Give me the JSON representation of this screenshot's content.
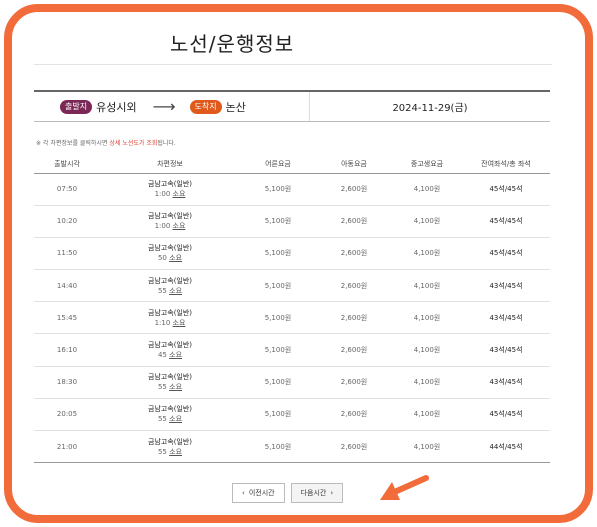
{
  "page": {
    "title": "노선/운행정보",
    "departure_badge": "출발지",
    "departure": "유성시외",
    "arrival_badge": "도착지",
    "arrival": "논산",
    "date": "2024-11-29(금)",
    "notice_prefix": "※ 각 차편정보를 클릭하시면 ",
    "notice_highlight": "상세 노선도가 조회",
    "notice_suffix": "됩니다."
  },
  "table": {
    "headers": [
      "출발시각",
      "차편정보",
      "어른요금",
      "아동요금",
      "중고생요금",
      "잔여좌석/총 좌석"
    ],
    "rows": [
      {
        "time": "07:50",
        "bus": "금남고속(일반)",
        "dur": "1:00",
        "dur_suffix": "소요",
        "adult": "5,100원",
        "child": "2,600원",
        "youth": "4,100원",
        "seats": "45석/45석"
      },
      {
        "time": "10:20",
        "bus": "금남고속(일반)",
        "dur": "1:00",
        "dur_suffix": "소요",
        "adult": "5,100원",
        "child": "2,600원",
        "youth": "4,100원",
        "seats": "45석/45석"
      },
      {
        "time": "11:50",
        "bus": "금남고속(일반)",
        "dur": "50",
        "dur_suffix": "소요",
        "adult": "5,100원",
        "child": "2,600원",
        "youth": "4,100원",
        "seats": "45석/45석"
      },
      {
        "time": "14:40",
        "bus": "금남고속(일반)",
        "dur": "55",
        "dur_suffix": "소요",
        "adult": "5,100원",
        "child": "2,600원",
        "youth": "4,100원",
        "seats": "43석/45석"
      },
      {
        "time": "15:45",
        "bus": "금남고속(일반)",
        "dur": "1:10",
        "dur_suffix": "소요",
        "adult": "5,100원",
        "child": "2,600원",
        "youth": "4,100원",
        "seats": "43석/45석"
      },
      {
        "time": "16:10",
        "bus": "금남고속(일반)",
        "dur": "45",
        "dur_suffix": "소요",
        "adult": "5,100원",
        "child": "2,600원",
        "youth": "4,100원",
        "seats": "43석/45석"
      },
      {
        "time": "18:30",
        "bus": "금남고속(일반)",
        "dur": "55",
        "dur_suffix": "소요",
        "adult": "5,100원",
        "child": "2,600원",
        "youth": "4,100원",
        "seats": "43석/45석"
      },
      {
        "time": "20:05",
        "bus": "금남고속(일반)",
        "dur": "55",
        "dur_suffix": "소요",
        "adult": "5,100원",
        "child": "2,600원",
        "youth": "4,100원",
        "seats": "45석/45석"
      },
      {
        "time": "21:00",
        "bus": "금남고속(일반)",
        "dur": "55",
        "dur_suffix": "소요",
        "adult": "5,100원",
        "child": "2,600원",
        "youth": "4,100원",
        "seats": "44석/45석"
      }
    ]
  },
  "pager": {
    "prev_label": "이전시간",
    "next_label": "다음시간",
    "prev_icon": "chevron-left-icon",
    "next_icon": "chevron-right-icon"
  },
  "colors": {
    "frame": "#f26b3a",
    "departure_badge": "#7b2857",
    "arrival_badge": "#e05a1c",
    "pointer_arrow": "#f26b3a"
  }
}
